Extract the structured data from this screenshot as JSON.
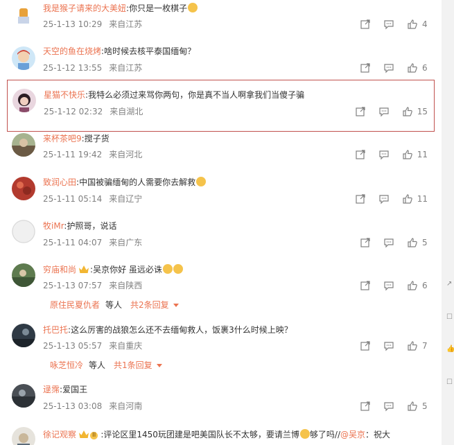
{
  "comments": [
    {
      "user": "我是猴子请来的大美妞",
      "text": "你只是一枚棋子",
      "emoji": true,
      "time": "25-1-13 10:29",
      "location": "来自江苏",
      "likes": "4"
    },
    {
      "user": "天空的鱼在烧烤",
      "text": "啥时候去核平泰国缅甸？",
      "time": "25-1-12 13:55",
      "location": "来自江苏",
      "likes": "6"
    },
    {
      "user": "星猫不快乐",
      "text": "我特么必须过来骂你两句，你是真不当人啊拿我们当傻子骗",
      "time": "25-1-12 02:32",
      "location": "来自湖北",
      "likes": "15"
    },
    {
      "user": "来杯茶吧9",
      "text": "搅子货",
      "time": "25-1-11 19:42",
      "location": "来自河北",
      "likes": "11"
    },
    {
      "user": "致润心田",
      "text": "中国被骗缅甸的人需要你去解救",
      "emoji": true,
      "time": "25-1-11 05:14",
      "location": "来自辽宁",
      "likes": "11"
    },
    {
      "user": "牧iMr",
      "text": "护照哥，说话",
      "time": "25-1-11 04:07",
      "location": "来自广东",
      "likes": "5"
    },
    {
      "user": "穷庙和尚",
      "text": "吴京你好 虽远必诛",
      "emoji2": true,
      "time": "25-1-13 07:57",
      "location": "来自陕西",
      "likes": "6",
      "reply_user": "原住民夏仇者",
      "reply_etc": "等人",
      "reply_more": "共2条回复"
    },
    {
      "user": "托巴托",
      "text": "这么厉害的战狼怎么还不去缅甸救人，饭裹3什么时候上映？",
      "time": "25-1-13 05:57",
      "location": "来自重庆",
      "likes": "7",
      "reply_user": "咏芝恒冷",
      "reply_etc": "等人",
      "reply_more": "共1条回复"
    },
    {
      "user": "逯霈",
      "text": "爱国王",
      "time": "25-1-13 03:08",
      "location": "来自河南",
      "likes": "5"
    },
    {
      "user": "徐记观察",
      "badge": "II",
      "text": "评论区里1450玩团建是吧美国队长不太够，要请兰博",
      "text2": "够了吗//",
      "mention": "@吴京",
      "text3": "：祝大",
      "emoji": true
    }
  ],
  "colors": {
    "username": "#eb7350",
    "meta": "#808080",
    "highlight_border": "#c0504d"
  },
  "icons": [
    "share-icon",
    "comment-icon",
    "like-icon"
  ]
}
